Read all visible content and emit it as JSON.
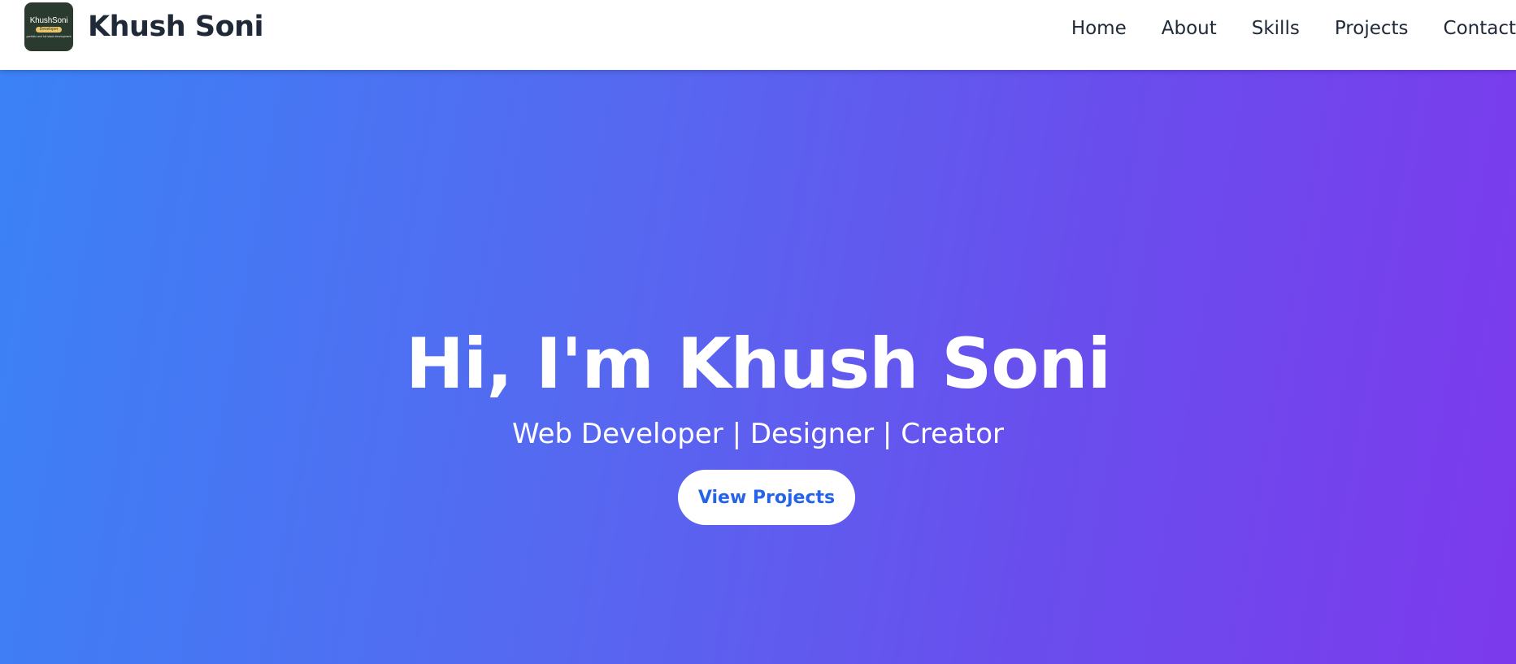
{
  "header": {
    "logo": {
      "name": "KhushSoni",
      "badge": "Developer",
      "tagline": "portfolio and full stack development"
    },
    "brand_name": "Khush Soni",
    "nav": [
      "Home",
      "About",
      "Skills",
      "Projects",
      "Contact"
    ]
  },
  "hero": {
    "title": "Hi, I'm Khush Soni",
    "subtitle": "Web Developer | Designer | Creator",
    "cta_label": "View Projects"
  },
  "colors": {
    "nav_background": "#ffffff",
    "brand_text": "#1f2937",
    "hero_gradient_start": "#3b82f6",
    "hero_gradient_end": "#7c3aed",
    "cta_text": "#2563eb",
    "logo_background": "#2a3a2e"
  }
}
